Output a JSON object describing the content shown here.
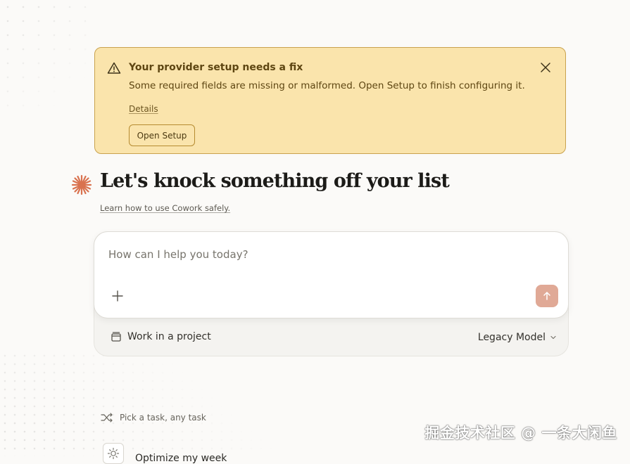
{
  "banner": {
    "title": "Your provider setup needs a fix",
    "message": "Some required fields are missing or malformed. Open Setup to finish configuring it.",
    "details_link": "Details",
    "open_setup_label": "Open Setup",
    "icons": {
      "warning": "warning-triangle-icon",
      "close": "close-icon"
    },
    "colors": {
      "background": "#fae4ac",
      "border": "#c9a24e",
      "text": "#5e4612"
    }
  },
  "hero": {
    "title": "Let's knock something off your list",
    "learn_link": "Learn how to use Cowork safely.",
    "icon": "asterisk-spark-icon",
    "accent_color": "#d9724f"
  },
  "composer": {
    "placeholder": "How can I help you today?",
    "value": "",
    "icons": {
      "add": "plus-icon",
      "send": "arrow-up-icon"
    },
    "send_color": "#e0a996"
  },
  "footer_controls": {
    "project_label": "Work in a project",
    "project_icon": "folder-icon",
    "model_label": "Legacy Model",
    "model_icon": "chevron-down-icon"
  },
  "suggestions": {
    "heading": "Pick a task, any task",
    "heading_icon": "shuffle-icon",
    "items": [
      {
        "label": "Optimize my week",
        "icon": "sun-icon"
      }
    ]
  },
  "watermark": "掘金技术社区 @ 一条大闲鱼"
}
